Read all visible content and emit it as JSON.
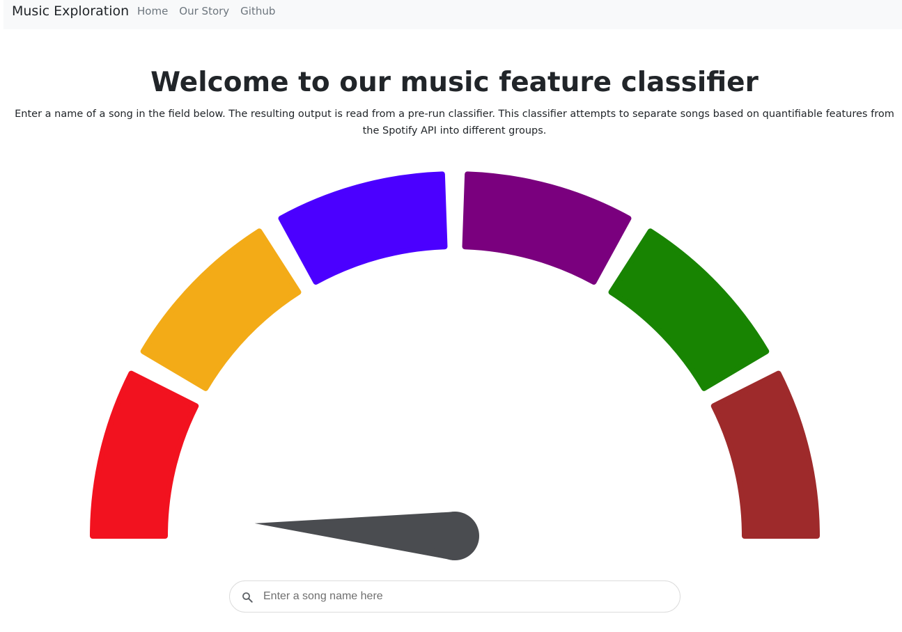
{
  "navbar": {
    "brand": "Music Exploration",
    "links": [
      "Home",
      "Our Story",
      "Github"
    ]
  },
  "hero": {
    "title": "Welcome to our music feature classifier",
    "intro": "Enter a name of a song in the field below. The resulting output is read from a pre-run classifier. This classifier attempts to separate songs based on quantifiable features from the Spotify API into different groups."
  },
  "gauge": {
    "segments": [
      {
        "color": "#f2121f"
      },
      {
        "color": "#f3ab17"
      },
      {
        "color": "#4b00ff"
      },
      {
        "color": "#7a007e"
      },
      {
        "color": "#188402"
      },
      {
        "color": "#9e2a2b"
      }
    ],
    "needle_color": "#4a4c50",
    "needle_value_fraction": 0.02
  },
  "search": {
    "placeholder": "Enter a song name here",
    "value": "",
    "icon": "search-icon"
  }
}
